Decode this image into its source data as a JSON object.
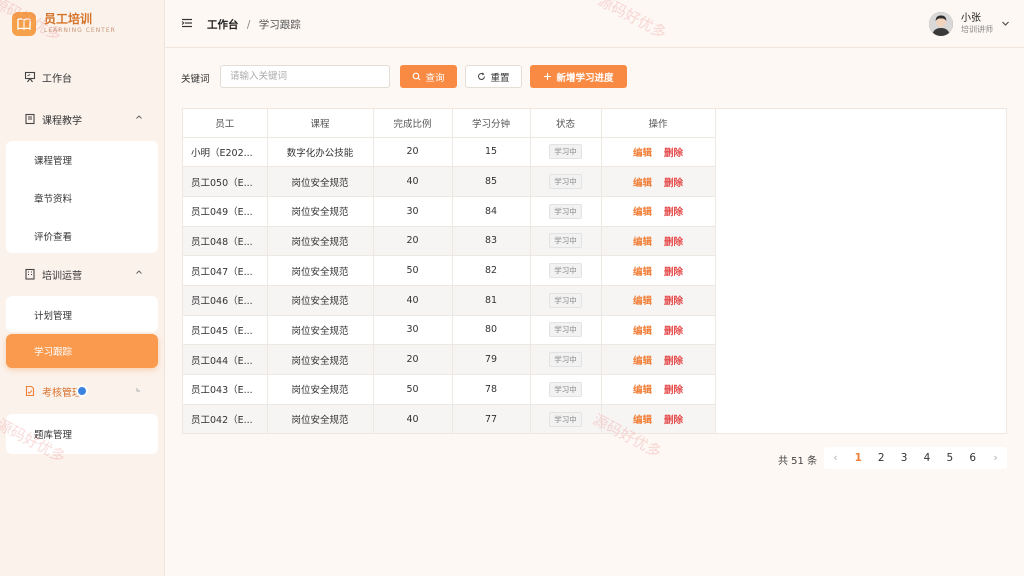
{
  "brand": {
    "title": "员工培训",
    "subtitle": "LEARNING CENTER"
  },
  "sidebar": {
    "workbench": "工作台",
    "course_group": {
      "label": "课程教学",
      "items": [
        "课程管理",
        "章节资料",
        "评价查看"
      ]
    },
    "ops_group": {
      "label": "培训运营",
      "items": [
        "计划管理",
        "学习跟踪"
      ]
    },
    "exam_group": {
      "label": "考核管理",
      "items": [
        "题库管理"
      ]
    }
  },
  "header": {
    "breadcrumb_home": "工作台",
    "breadcrumb_sep": "/",
    "breadcrumb_current": "学习跟踪",
    "user_name": "小张",
    "user_role": "培训讲师"
  },
  "filter": {
    "label": "关键词",
    "placeholder": "请输入关键词",
    "value": "",
    "query_label": "查询",
    "reset_label": "重置",
    "add_label": "新增学习进度"
  },
  "table": {
    "columns": [
      "员工",
      "课程",
      "完成比例",
      "学习分钟",
      "状态",
      "操作"
    ],
    "rows": [
      {
        "employee": "小明（E202...",
        "course": "数字化办公技能",
        "ratio": "20",
        "minutes": "15",
        "status": "学习中"
      },
      {
        "employee": "员工050（E...",
        "course": "岗位安全规范",
        "ratio": "40",
        "minutes": "85",
        "status": "学习中"
      },
      {
        "employee": "员工049（E...",
        "course": "岗位安全规范",
        "ratio": "30",
        "minutes": "84",
        "status": "学习中"
      },
      {
        "employee": "员工048（E...",
        "course": "岗位安全规范",
        "ratio": "20",
        "minutes": "83",
        "status": "学习中"
      },
      {
        "employee": "员工047（E...",
        "course": "岗位安全规范",
        "ratio": "50",
        "minutes": "82",
        "status": "学习中"
      },
      {
        "employee": "员工046（E...",
        "course": "岗位安全规范",
        "ratio": "40",
        "minutes": "81",
        "status": "学习中"
      },
      {
        "employee": "员工045（E...",
        "course": "岗位安全规范",
        "ratio": "30",
        "minutes": "80",
        "status": "学习中"
      },
      {
        "employee": "员工044（E...",
        "course": "岗位安全规范",
        "ratio": "20",
        "minutes": "79",
        "status": "学习中"
      },
      {
        "employee": "员工043（E...",
        "course": "岗位安全规范",
        "ratio": "50",
        "minutes": "78",
        "status": "学习中"
      },
      {
        "employee": "员工042（E...",
        "course": "岗位安全规范",
        "ratio": "40",
        "minutes": "77",
        "status": "学习中"
      }
    ],
    "edit_label": "编辑",
    "delete_label": "删除"
  },
  "pagination": {
    "total_text": "共 51 条",
    "pages": [
      "1",
      "2",
      "3",
      "4",
      "5",
      "6"
    ],
    "current": "1",
    "prev": "‹",
    "next": "›"
  },
  "watermark": "源码好优多",
  "colors": {
    "accent": "#f98a43",
    "danger": "#e54b4b",
    "sidebar_bg": "#fbf2ec"
  },
  "icons": [
    "book-icon",
    "presentation-icon",
    "book-open-icon",
    "building-icon",
    "document-icon",
    "menu-fold-icon",
    "chevron-up-icon",
    "chevron-down-icon",
    "search-icon",
    "refresh-icon",
    "plus-icon"
  ]
}
